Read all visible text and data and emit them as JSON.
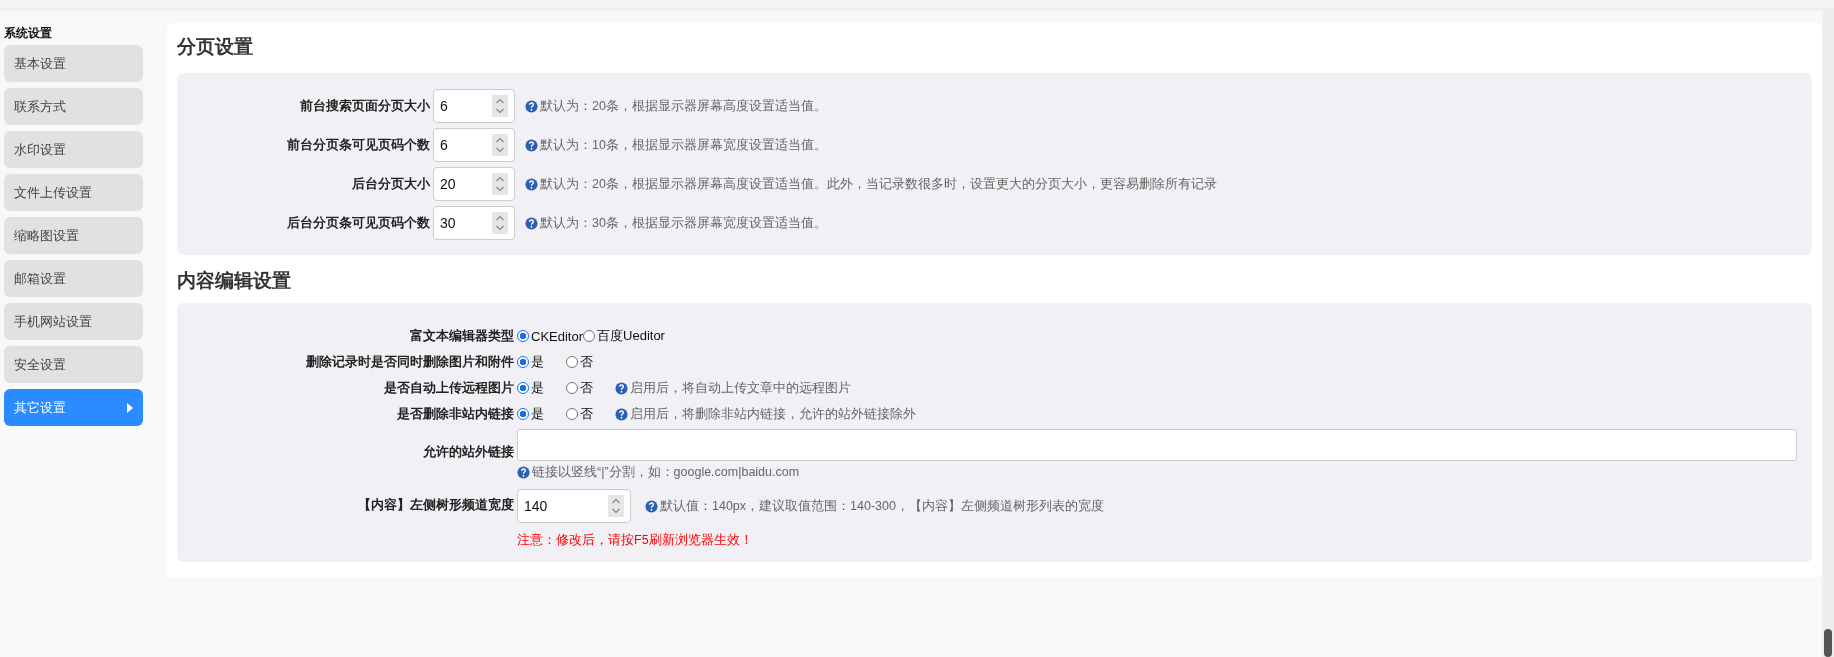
{
  "sidebar": {
    "title": "系统设置",
    "items": [
      {
        "label": "基本设置",
        "selected": false
      },
      {
        "label": "联系方式",
        "selected": false
      },
      {
        "label": "水印设置",
        "selected": false
      },
      {
        "label": "文件上传设置",
        "selected": false
      },
      {
        "label": "缩略图设置",
        "selected": false
      },
      {
        "label": "邮箱设置",
        "selected": false
      },
      {
        "label": "手机网站设置",
        "selected": false
      },
      {
        "label": "安全设置",
        "selected": false
      },
      {
        "label": "其它设置",
        "selected": true
      }
    ]
  },
  "sections": [
    {
      "title": "分页设置",
      "rows": [
        {
          "kind": "number",
          "label": "前台搜索页面分页大小",
          "value": "6",
          "help": "默认为：20条，根据显示器屏幕高度设置适当值。"
        },
        {
          "kind": "number",
          "label": "前台分页条可见页码个数",
          "value": "6",
          "help": "默认为：10条，根据显示器屏幕宽度设置适当值。"
        },
        {
          "kind": "number",
          "label": "后台分页大小",
          "value": "20",
          "help": "默认为：20条，根据显示器屏幕高度设置适当值。此外，当记录数很多时，设置更大的分页大小，更容易删除所有记录"
        },
        {
          "kind": "number",
          "label": "后台分页条可见页码个数",
          "value": "30",
          "help": "默认为：30条，根据显示器屏幕宽度设置适当值。"
        }
      ]
    },
    {
      "title": "内容编辑设置",
      "rows": [
        {
          "kind": "radio",
          "label": "富文本编辑器类型",
          "options": [
            {
              "label": "CKEditor",
              "selected": true
            },
            {
              "label": "百度Ueditor",
              "selected": false
            }
          ]
        },
        {
          "kind": "radio",
          "label": "删除记录时是否同时删除图片和附件",
          "options": [
            {
              "label": "是",
              "selected": true
            },
            {
              "label": "否",
              "selected": false
            }
          ]
        },
        {
          "kind": "radio",
          "label": "是否自动上传远程图片",
          "options": [
            {
              "label": "是",
              "selected": true
            },
            {
              "label": "否",
              "selected": false
            }
          ],
          "help": "启用后，将自动上传文章中的远程图片"
        },
        {
          "kind": "radio",
          "label": "是否删除非站内链接",
          "options": [
            {
              "label": "是",
              "selected": true
            },
            {
              "label": "否",
              "selected": false
            }
          ],
          "help": "启用后，将删除非站内链接，允许的站外链接除外"
        },
        {
          "kind": "text",
          "label": "允许的站外链接",
          "help": "链接以竖线“|”分割，如：google.com|baidu.com"
        },
        {
          "kind": "wide-number",
          "label": "【内容】左侧树形频道宽度",
          "value": "140",
          "help": "默认值：140px，建议取值范围：140-300，【内容】左侧频道树形列表的宽度",
          "notice": "注意：修改后，请按F5刷新浏览器生效！"
        }
      ]
    }
  ]
}
